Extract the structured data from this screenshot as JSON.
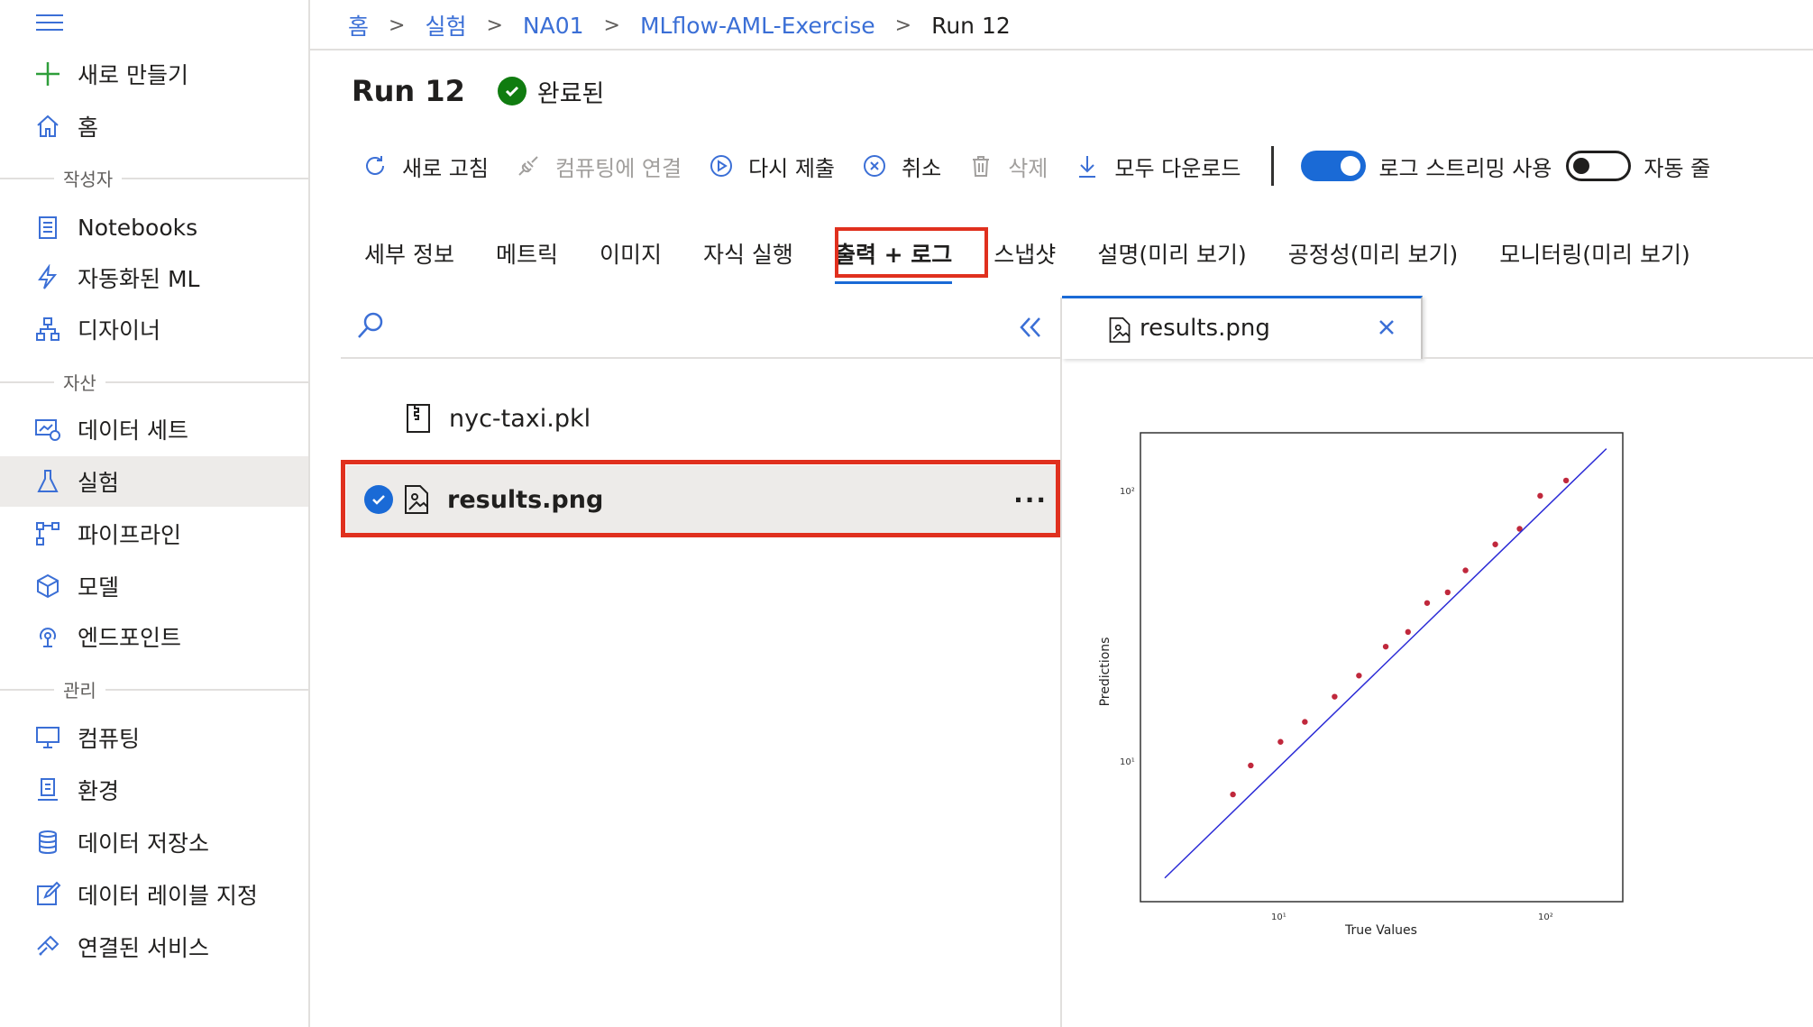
{
  "sidebar": {
    "items": [
      {
        "label": "새로 만들기",
        "icon": "plus-icon"
      },
      {
        "label": "홈",
        "icon": "home-icon"
      },
      {
        "label": "Notebooks",
        "icon": "notebook-icon"
      },
      {
        "label": "자동화된 ML",
        "icon": "automl-icon"
      },
      {
        "label": "디자이너",
        "icon": "designer-icon"
      },
      {
        "label": "데이터 세트",
        "icon": "dataset-icon"
      },
      {
        "label": "실험",
        "icon": "flask-icon"
      },
      {
        "label": "파이프라인",
        "icon": "pipeline-icon"
      },
      {
        "label": "모델",
        "icon": "cube-icon"
      },
      {
        "label": "엔드포인트",
        "icon": "endpoint-icon"
      },
      {
        "label": "컴퓨팅",
        "icon": "monitor-icon"
      },
      {
        "label": "환경",
        "icon": "environment-icon"
      },
      {
        "label": "데이터 저장소",
        "icon": "database-icon"
      },
      {
        "label": "데이터 레이블 지정",
        "icon": "edit-icon"
      },
      {
        "label": "연결된 서비스",
        "icon": "link-icon"
      }
    ],
    "sections": {
      "author": "작성자",
      "assets": "자산",
      "manage": "관리"
    }
  },
  "breadcrumb": [
    "홈",
    "실험",
    "NA01",
    "MLflow-AML-Exercise",
    "Run 12"
  ],
  "run": {
    "title": "Run 12",
    "status": "완료된"
  },
  "toolbar": {
    "refresh": "새로 고침",
    "connect_compute": "컴퓨팅에 연결",
    "resubmit": "다시 제출",
    "cancel": "취소",
    "delete": "삭제",
    "download_all": "모두 다운로드",
    "log_streaming": "로그 스트리밍 사용",
    "auto_wrap": "자동 줄"
  },
  "tabs": [
    "세부 정보",
    "메트릭",
    "이미지",
    "자식 실행",
    "출력 + 로그",
    "스냅샷",
    "설명(미리 보기)",
    "공정성(미리 보기)",
    "모니터링(미리 보기)"
  ],
  "files": [
    "nyc-taxi.pkl",
    "results.png"
  ],
  "preview": {
    "filename": "results.png"
  },
  "colors": {
    "accent": "#1a6ad6",
    "highlight": "#e0301e",
    "success": "#107c10",
    "point": "#c0283c",
    "line": "#2b2bd6"
  },
  "chart_data": {
    "type": "scatter",
    "xlabel": "True Values",
    "ylabel": "Predictions",
    "x_ticks": [
      "10¹",
      "10²"
    ],
    "y_ticks": [
      "10¹",
      "10²"
    ],
    "scale": "log",
    "series": [
      {
        "values": [
          [
            7,
            8
          ],
          [
            8,
            10
          ],
          [
            10,
            12
          ],
          [
            12,
            14
          ],
          [
            15,
            17
          ],
          [
            18,
            20
          ],
          [
            22,
            25
          ],
          [
            26,
            28
          ],
          [
            30,
            35
          ],
          [
            35,
            38
          ],
          [
            40,
            45
          ],
          [
            50,
            55
          ],
          [
            60,
            62
          ],
          [
            70,
            80
          ],
          [
            85,
            90
          ]
        ]
      }
    ],
    "reference_line": "y = x"
  }
}
